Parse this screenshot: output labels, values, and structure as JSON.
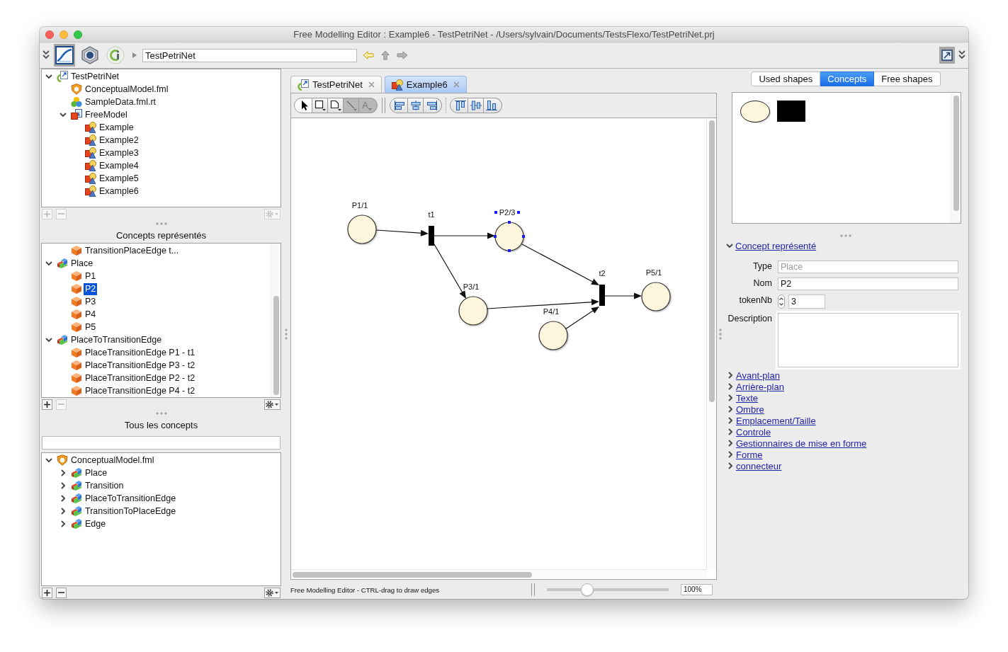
{
  "window": {
    "title": "Free Modelling Editor : Example6 - TestPetriNet - /Users/sylvain/Documents/TestsFlexo/TestPetriNet.prj"
  },
  "toolbar": {
    "perspectives": [
      {
        "kind": "curve",
        "selected": true
      },
      {
        "kind": "hexagon",
        "selected": false
      },
      {
        "kind": "ring",
        "selected": false
      }
    ],
    "path": {
      "value": "TestPetriNet"
    },
    "navigation": [
      {
        "kind": "back",
        "disabled": false
      },
      {
        "kind": "up",
        "disabled": true
      },
      {
        "kind": "forward",
        "disabled": true
      }
    ],
    "layout_toggle": {
      "selected": true
    }
  },
  "project_tree": {
    "items": [
      {
        "label": "TestPetriNet",
        "kind": "project",
        "expanded": true,
        "selected": false,
        "children": [
          {
            "label": "ConceptualModel.fml",
            "kind": "model",
            "selected": false
          },
          {
            "label": "SampleData.fml.rt",
            "kind": "data",
            "selected": false
          },
          {
            "label": "FreeModel",
            "kind": "free-model",
            "expanded": true,
            "selected": false,
            "children": [
              {
                "label": "Example",
                "kind": "diagram",
                "selected": false
              },
              {
                "label": "Example2",
                "kind": "diagram",
                "selected": false
              },
              {
                "label": "Example3",
                "kind": "diagram",
                "selected": false
              },
              {
                "label": "Example4",
                "kind": "diagram",
                "selected": false
              },
              {
                "label": "Example5",
                "kind": "diagram",
                "selected": false
              },
              {
                "label": "Example6",
                "kind": "diagram",
                "selected": false
              }
            ]
          }
        ]
      }
    ],
    "buttons": [
      {
        "kind": "add",
        "disabled": true
      },
      {
        "kind": "remove",
        "disabled": true
      },
      {
        "kind": "settings",
        "disabled": true
      }
    ]
  },
  "represented_concepts": {
    "title": "Concepts représentés",
    "items": [
      {
        "children": [
          {
            "label": "TransitionPlaceEdge t...",
            "kind": "instance",
            "selected": false
          }
        ]
      },
      {
        "label": "Place",
        "kind": "concept",
        "expanded": true,
        "selected": false,
        "children": [
          {
            "label": "P1",
            "kind": "instance",
            "selected": false
          },
          {
            "label": "P2",
            "kind": "instance",
            "selected": true
          },
          {
            "label": "P3",
            "kind": "instance",
            "selected": false
          },
          {
            "label": "P4",
            "kind": "instance",
            "selected": false
          },
          {
            "label": "P5",
            "kind": "instance",
            "selected": false
          }
        ]
      },
      {
        "label": "PlaceToTransitionEdge",
        "kind": "concept",
        "expanded": true,
        "selected": false,
        "children": [
          {
            "label": "PlaceTransitionEdge P1 - t1",
            "kind": "instance",
            "selected": false
          },
          {
            "label": "PlaceTransitionEdge P3 - t2",
            "kind": "instance",
            "selected": false
          },
          {
            "label": "PlaceTransitionEdge P2 - t2",
            "kind": "instance",
            "selected": false
          },
          {
            "label": "PlaceTransitionEdge P4 - t2",
            "kind": "instance",
            "selected": false
          }
        ]
      }
    ],
    "buttons": [
      {
        "kind": "add",
        "disabled": false
      },
      {
        "kind": "remove",
        "disabled": true
      },
      {
        "kind": "settings",
        "disabled": false
      }
    ]
  },
  "all_concepts": {
    "title": "Tous les concepts",
    "items": [
      {
        "label": "ConceptualModel.fml",
        "kind": "model",
        "expanded": true,
        "selected": false,
        "children": [
          {
            "label": "Place",
            "kind": "concept",
            "expanded": false,
            "selected": false
          },
          {
            "label": "Transition",
            "kind": "concept",
            "expanded": false,
            "selected": false
          },
          {
            "label": "PlaceToTransitionEdge",
            "kind": "concept",
            "expanded": false,
            "selected": false
          },
          {
            "label": "TransitionToPlaceEdge",
            "kind": "concept",
            "expanded": false,
            "selected": false
          },
          {
            "label": "Edge",
            "kind": "concept",
            "expanded": false,
            "selected": false
          }
        ]
      }
    ],
    "buttons": [
      {
        "kind": "add",
        "disabled": false
      },
      {
        "kind": "remove",
        "disabled": false
      },
      {
        "kind": "settings",
        "disabled": false
      }
    ]
  },
  "editor": {
    "tabs": [
      {
        "label": "TestPetriNet",
        "kind": "project",
        "selected": false
      },
      {
        "label": "Example6",
        "kind": "diagram",
        "selected": true
      }
    ],
    "tools": [
      {
        "kind": "select",
        "selected": true,
        "disabled": false
      },
      {
        "kind": "rectangle",
        "selected": false,
        "disabled": false
      },
      {
        "kind": "shape",
        "selected": false,
        "disabled": false
      },
      {
        "kind": "connector",
        "selected": false,
        "disabled": true
      },
      {
        "kind": "text",
        "label": "A",
        "selected": false,
        "disabled": true
      }
    ],
    "diagram": {
      "nodes": [
        {
          "kind": "place",
          "label": "P1/1",
          "selected": false
        },
        {
          "kind": "transition",
          "label": "t1",
          "selected": false
        },
        {
          "kind": "place",
          "label": "P2/3",
          "selected": true
        },
        {
          "kind": "place",
          "label": "P3/1",
          "selected": false
        },
        {
          "kind": "place",
          "label": "P4/1",
          "selected": false
        },
        {
          "kind": "transition",
          "label": "t2",
          "selected": false
        },
        {
          "kind": "place",
          "label": "P5/1",
          "selected": false
        }
      ]
    }
  },
  "status_bar": {
    "message": "Free Modelling Editor - CTRL-drag to draw edges",
    "zoom": {
      "level": 0.31,
      "value": "100%"
    }
  },
  "inspector": {
    "views": [
      {
        "label": "Used shapes",
        "selected": false
      },
      {
        "label": "Concepts",
        "selected": true
      },
      {
        "label": "Free shapes",
        "selected": false
      }
    ],
    "palette": [
      {
        "kind": "ellipse"
      },
      {
        "kind": "rectangle"
      }
    ],
    "sections": [
      {
        "label": "Concept représenté",
        "expanded": true,
        "fields": [
          {
            "label": "Type",
            "kind": "text",
            "value": "Place",
            "disabled": true
          },
          {
            "label": "Nom",
            "kind": "text",
            "value": "P2",
            "disabled": false
          },
          {
            "label": "tokenNb",
            "kind": "spinner",
            "value": "3"
          },
          {
            "label": "Description",
            "kind": "textarea"
          }
        ]
      },
      {
        "label": "Avant-plan",
        "expanded": false
      },
      {
        "label": "Arrière-plan",
        "expanded": false
      },
      {
        "label": "Texte",
        "expanded": false
      },
      {
        "label": "Ombre",
        "expanded": false
      },
      {
        "label": "Emplacement/Taille",
        "expanded": false
      },
      {
        "label": "Controle",
        "expanded": false
      },
      {
        "label": "Gestionnaires de mise en forme",
        "expanded": false
      },
      {
        "label": "Forme",
        "expanded": false
      },
      {
        "label": "connecteur",
        "expanded": false
      }
    ]
  }
}
